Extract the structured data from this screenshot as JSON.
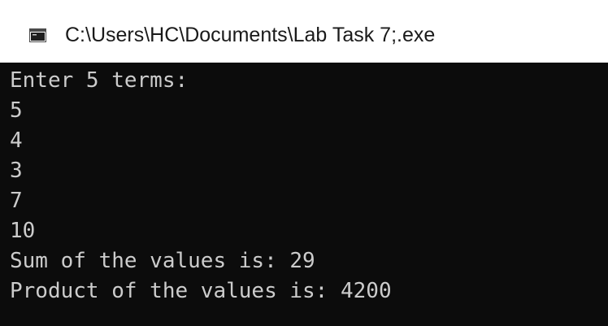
{
  "window": {
    "title": "C:\\Users\\HC\\Documents\\Lab Task 7;.exe",
    "icon": "console-app-icon"
  },
  "console": {
    "lines": [
      "Enter 5 terms:",
      "5",
      "4",
      "3",
      "7",
      "10",
      "Sum of the values is: 29",
      "Product of the values is: 4200"
    ]
  },
  "colors": {
    "console_background": "#0c0c0c",
    "console_text": "#cccccc",
    "titlebar_background": "#ffffff"
  }
}
